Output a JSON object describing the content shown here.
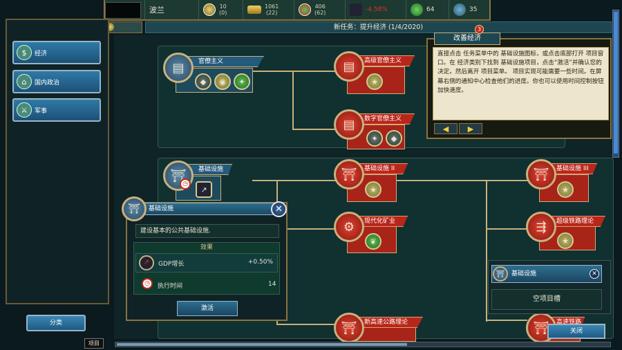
{
  "topbar": {
    "country": "波兰",
    "stat1_top": "10",
    "stat1_bottom": "(0)",
    "stat2_top": "1061",
    "stat2_bottom": "(22)",
    "stat3_top": "406",
    "stat3_bottom": "(62)",
    "gdp_change": "-4.58%",
    "stability": "64",
    "population": "35"
  },
  "task_banner": "新任务：提升经济 (1/4/2020)",
  "sidebar": {
    "items": [
      {
        "label": "经济"
      },
      {
        "label": "国内政治"
      },
      {
        "label": "军事"
      }
    ],
    "sort_label": "分类",
    "projects_label": "项目"
  },
  "tree": {
    "bureaucracy": "官僚主义",
    "adv_bureaucracy": "高级官僚主义",
    "digital_bureaucracy": "数字官僚主义",
    "infrastructure": "基础设施",
    "infrastructure2": "基础设施 II",
    "infrastructure3": "基础设施 III",
    "modern_mining": "现代化矿业",
    "superrail": "超级铁路理论",
    "highway": "新高速公路理论",
    "hidden_partial": "高速铁路"
  },
  "tooltip": {
    "title": "改善经济",
    "badge": "3",
    "text": "直接点击 任务菜单中的 基础设施图标，或点击底部打开 项目窗口。在 经济类别下找到 基础设施项目，点击“激活”并确认您的决定。然后离开 项目菜单。 项目实现可能需要一些时间。在屏幕右侧的通知中心检查他们的进度。你也可以使用时间控制按钮加快速度。"
  },
  "detail": {
    "title": "基础设施",
    "description": "建设基本的公共基础设施.",
    "effect_title": "效果",
    "gdp_label": "GDP增长",
    "gdp_value": "+0.50%",
    "time_label": "执行时间",
    "time_value": "14",
    "activate": "激活"
  },
  "mini": {
    "title": "基础设施",
    "empty": "空项目槽",
    "close": "关闭"
  },
  "colors": {
    "red_node": "#b8261a",
    "blue_node": "#245a7c",
    "gold_border": "#8a7440",
    "gdp_negative": "#e03020"
  },
  "icons": [
    "star-icon",
    "gold-bars-icon",
    "cycle-arrows-icon",
    "trend-chart-icon",
    "leaf-icon",
    "globe-icon",
    "clock-icon",
    "close-icon",
    "arrow-left-icon",
    "arrow-right-icon"
  ]
}
